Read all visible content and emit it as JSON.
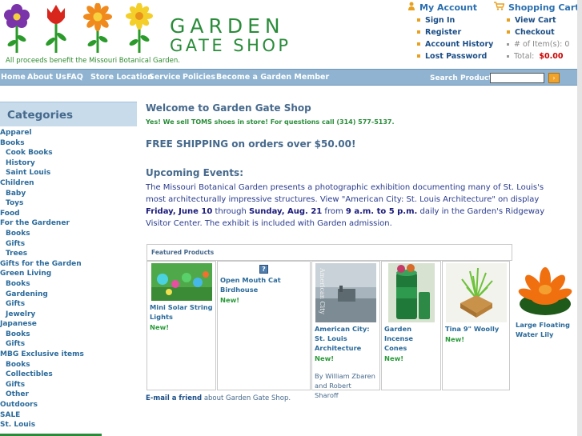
{
  "header": {
    "brand_line1": "GARDEN",
    "brand_line2": "GATE SHOP",
    "tagline": "All proceeds benefit the Missouri Botanical Garden.",
    "my_account": {
      "title": "My Account",
      "icon": "person-icon",
      "links": [
        "Sign In",
        "Register",
        "Account History",
        "Lost Password"
      ]
    },
    "cart": {
      "title": "Shopping Cart",
      "icon": "cart-icon",
      "links": [
        "View Cart",
        "Checkout"
      ],
      "items_label": "# of Item(s): 0",
      "total_label": "Total:",
      "total_value": "$0.00"
    }
  },
  "nav": {
    "items": [
      "Home",
      "About Us",
      "FAQ",
      "Store Location",
      "Service",
      "Policies",
      "Become a Garden Member"
    ],
    "search_label": "Search Products",
    "search_value": "",
    "search_button": "›"
  },
  "sidebar": {
    "title": "Categories",
    "items": [
      {
        "label": "Apparel",
        "sub": false
      },
      {
        "label": "Books",
        "sub": false
      },
      {
        "label": "Cook Books",
        "sub": true
      },
      {
        "label": "History",
        "sub": true
      },
      {
        "label": "Saint Louis",
        "sub": true
      },
      {
        "label": "Children",
        "sub": false
      },
      {
        "label": "Baby",
        "sub": true
      },
      {
        "label": "Toys",
        "sub": true
      },
      {
        "label": "Food",
        "sub": false
      },
      {
        "label": "For the Gardener",
        "sub": false
      },
      {
        "label": "Books",
        "sub": true
      },
      {
        "label": "Gifts",
        "sub": true
      },
      {
        "label": "Trees",
        "sub": true
      },
      {
        "label": "Gifts for the Garden",
        "sub": false
      },
      {
        "label": "Green Living",
        "sub": false
      },
      {
        "label": "Books",
        "sub": true
      },
      {
        "label": "Gardening",
        "sub": true
      },
      {
        "label": "Gifts",
        "sub": true
      },
      {
        "label": "Jewelry",
        "sub": true
      },
      {
        "label": "Japanese",
        "sub": false
      },
      {
        "label": "Books",
        "sub": true
      },
      {
        "label": "Gifts",
        "sub": true
      },
      {
        "label": "MBG Exclusive items",
        "sub": false
      },
      {
        "label": "Books",
        "sub": true
      },
      {
        "label": "Collectibles",
        "sub": true
      },
      {
        "label": "Gifts",
        "sub": true
      },
      {
        "label": "Other",
        "sub": true
      },
      {
        "label": "Outdoors",
        "sub": false
      },
      {
        "label": "SALE",
        "sub": false
      },
      {
        "label": "St. Louis",
        "sub": false
      }
    ]
  },
  "main": {
    "welcome": "Welcome to Garden Gate Shop",
    "toms_note": "Yes! We sell TOMS shoes in store! For questions call (314) 577-5137.",
    "shipping": "FREE SHIPPING on orders over $50.00!",
    "events_title": "Upcoming Events:",
    "events_pre": "The Missouri Botanical Garden presents a photographic exhibition documenting many of St. Louis's most architecturally impressive structures. View \"American City: St. Louis Architecture\" on display ",
    "events_date1": "Friday, June 10",
    "events_mid1": " through ",
    "events_date2": "Sunday, Aug. 21",
    "events_mid2": " from ",
    "events_time": "9 a.m. to 5 p.m.",
    "events_post": " daily in the Garden's Ridgeway Visitor Center. The exhibit is included with Garden admission.",
    "featured_title": "Featured Products",
    "products": [
      {
        "title": "Mini Solar String Lights",
        "badge": "New!",
        "author": ""
      },
      {
        "title": "Open Mouth Cat Birdhouse",
        "badge": "New!",
        "author": ""
      },
      {
        "title": "American City: St. Louis Architecture",
        "badge": "New!",
        "author": "By William Zbaren and Robert Sharoff"
      },
      {
        "title": "Garden Incense Cones",
        "badge": "New!",
        "author": ""
      },
      {
        "title": "Tina 9\" Woolly",
        "badge": "New!",
        "author": ""
      },
      {
        "title": "Large Floating Water Lily",
        "badge": "",
        "author": ""
      }
    ],
    "book_cover_text": "American City",
    "email_link": "E-mail a friend",
    "email_rest": " about Garden Gate Shop."
  },
  "colors": {
    "brand_green": "#2a8c3a",
    "nav_blue": "#8fb3d0",
    "link_blue": "#2b6a9a",
    "heading_blue": "#46698c",
    "cart_total_red": "#cc0000"
  }
}
